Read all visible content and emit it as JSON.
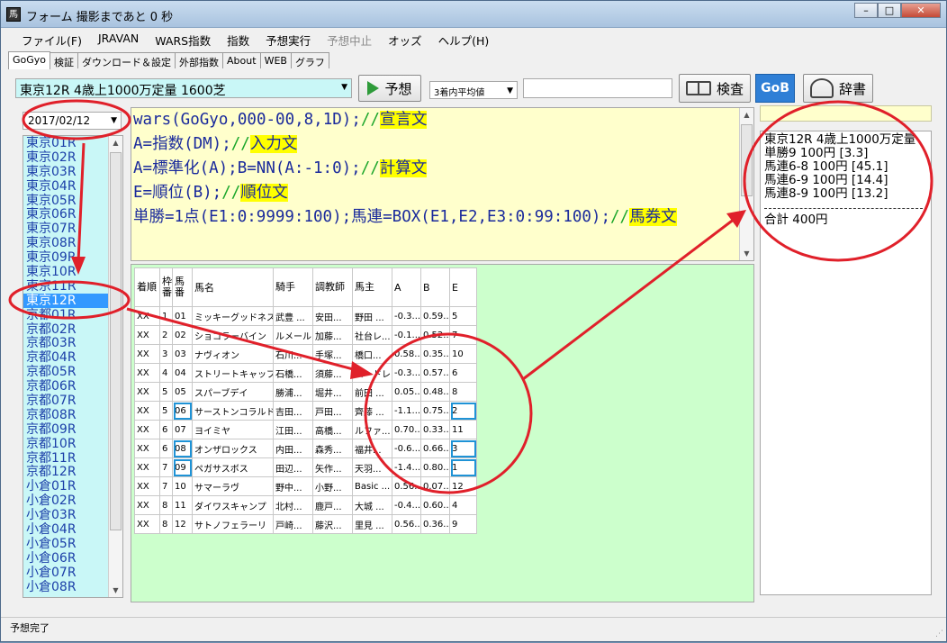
{
  "window": {
    "icon_label": "馬",
    "title": "フォーム 撮影まであと 0 秒",
    "minimize_glyph": "–",
    "maximize_glyph": "□",
    "close_glyph": "✕"
  },
  "menu": [
    "ファイル(F)",
    "JRAVAN",
    "WARS指数",
    "指数",
    "予想実行",
    "予想中止",
    "オッズ",
    "ヘルプ(H)"
  ],
  "menu_disabled_index": 5,
  "tabs": [
    "GoGyo",
    "検証",
    "ダウンロード＆設定",
    "外部指数",
    "About",
    "WEB",
    "グラフ"
  ],
  "toolbar": {
    "race_select": "東京12R 4歳上1000万定量 1600芝",
    "predict_button": "予想",
    "average_select": "3着内平均値",
    "search_value": "",
    "inspect_button": "検査",
    "gob_button": "GoB",
    "dictionary_button": "辞書"
  },
  "date_select": "2017/02/12",
  "race_list": [
    "東京01R",
    "東京02R",
    "東京03R",
    "東京04R",
    "東京05R",
    "東京06R",
    "東京07R",
    "東京08R",
    "東京09R",
    "東京10R",
    "東京11R",
    "東京12R",
    "京都01R",
    "京都02R",
    "京都03R",
    "京都04R",
    "京都05R",
    "京都06R",
    "京都07R",
    "京都08R",
    "京都09R",
    "京都10R",
    "京都11R",
    "京都12R",
    "小倉01R",
    "小倉02R",
    "小倉03R",
    "小倉04R",
    "小倉05R",
    "小倉06R",
    "小倉07R",
    "小倉08R"
  ],
  "race_list_selected": 11,
  "code": {
    "line1": "wars(GoGyo,000-00,8,1D);",
    "line1_comment": "//",
    "line1_label": "宣言文",
    "line2": "A=指数(DM);",
    "line2_comment": "//",
    "line2_label": "入力文",
    "line3": "A=標準化(A);B=NN(A:-1:0);",
    "line3_comment": "//",
    "line3_label": "計算文",
    "line4": "E=順位(B);",
    "line4_comment": "//",
    "line4_label": "順位文",
    "line5": "単勝=1点(E1:0:9999:100);馬連=BOX(E1,E2,E3:0:99:100);",
    "line5_comment": "//",
    "line5_label": "馬券文"
  },
  "grid": {
    "headers": [
      "着順",
      "枠番",
      "馬番",
      "馬名",
      "騎手",
      "調教師",
      "馬主",
      "A",
      "B",
      "E"
    ],
    "rows": [
      [
        "XX",
        "1",
        "01",
        "ミッキーグッドネス",
        "武豊 ...",
        "安田...",
        "野田 ...",
        "-0.3...",
        "0.59...",
        "5"
      ],
      [
        "XX",
        "2",
        "02",
        "ショコラーバイン",
        "ルメール",
        "加藤...",
        "社台レ...",
        "-0.1...",
        "0.52...",
        "7"
      ],
      [
        "XX",
        "3",
        "03",
        "ナヴィオン",
        "石川...",
        "手塚...",
        "橋口...",
        "0.58...",
        "0.35...",
        "10"
      ],
      [
        "XX",
        "4",
        "04",
        "ストリートキャップ",
        "石橋...",
        "須藤...",
        "ロードレ...",
        "-0.3...",
        "0.57...",
        "6"
      ],
      [
        "XX",
        "5",
        "05",
        "スパーブデイ",
        "勝浦...",
        "堀井...",
        "前田 ...",
        "0.05...",
        "0.48...",
        "8"
      ],
      [
        "XX",
        "5",
        "06",
        "サーストンコラルド",
        "吉田...",
        "戸田...",
        "齊藤 ...",
        "-1.1...",
        "0.75...",
        "2"
      ],
      [
        "XX",
        "6",
        "07",
        "ヨイミヤ",
        "江田...",
        "高橋...",
        "ルファ...",
        "0.70...",
        "0.33...",
        "11"
      ],
      [
        "XX",
        "6",
        "08",
        "オンザロックス",
        "内田...",
        "森秀...",
        "福井...",
        "-0.6...",
        "0.66...",
        "3"
      ],
      [
        "XX",
        "7",
        "09",
        "ペガサスボス",
        "田辺...",
        "矢作...",
        "天羽...",
        "-1.4...",
        "0.80...",
        "1"
      ],
      [
        "XX",
        "7",
        "10",
        "サマーラヴ",
        "野中...",
        "小野...",
        "Basic ...",
        "0.56...",
        "0.07...",
        "12"
      ],
      [
        "XX",
        "8",
        "11",
        "ダイワスキャンプ",
        "北村...",
        "鹿戸...",
        "大城 ...",
        "-0.4...",
        "0.60...",
        "4"
      ],
      [
        "XX",
        "8",
        "12",
        "サトノフェラーリ",
        "戸崎...",
        "藤沢...",
        "里見 ...",
        "0.56...",
        "0.36...",
        "9"
      ]
    ]
  },
  "results": {
    "header": "東京12R 4歳上1000万定量",
    "lines": [
      "単勝9 100円 [3.3]",
      "馬連6-8 100円 [45.1]",
      "馬連6-9 100円 [14.4]",
      "馬連8-9 100円 [13.2]"
    ],
    "total": "合計 400円"
  },
  "status": "予想完了",
  "colors": {
    "annotation_red": "#e0202a",
    "highlight_blue": "#1f93d6",
    "race_list_bg": "#c9f7f7",
    "editor_bg": "#ffffcc",
    "grid_area_bg": "#ccffcc",
    "comment_green": "#1aa62a",
    "keyword_yellow": "#ffff00"
  }
}
